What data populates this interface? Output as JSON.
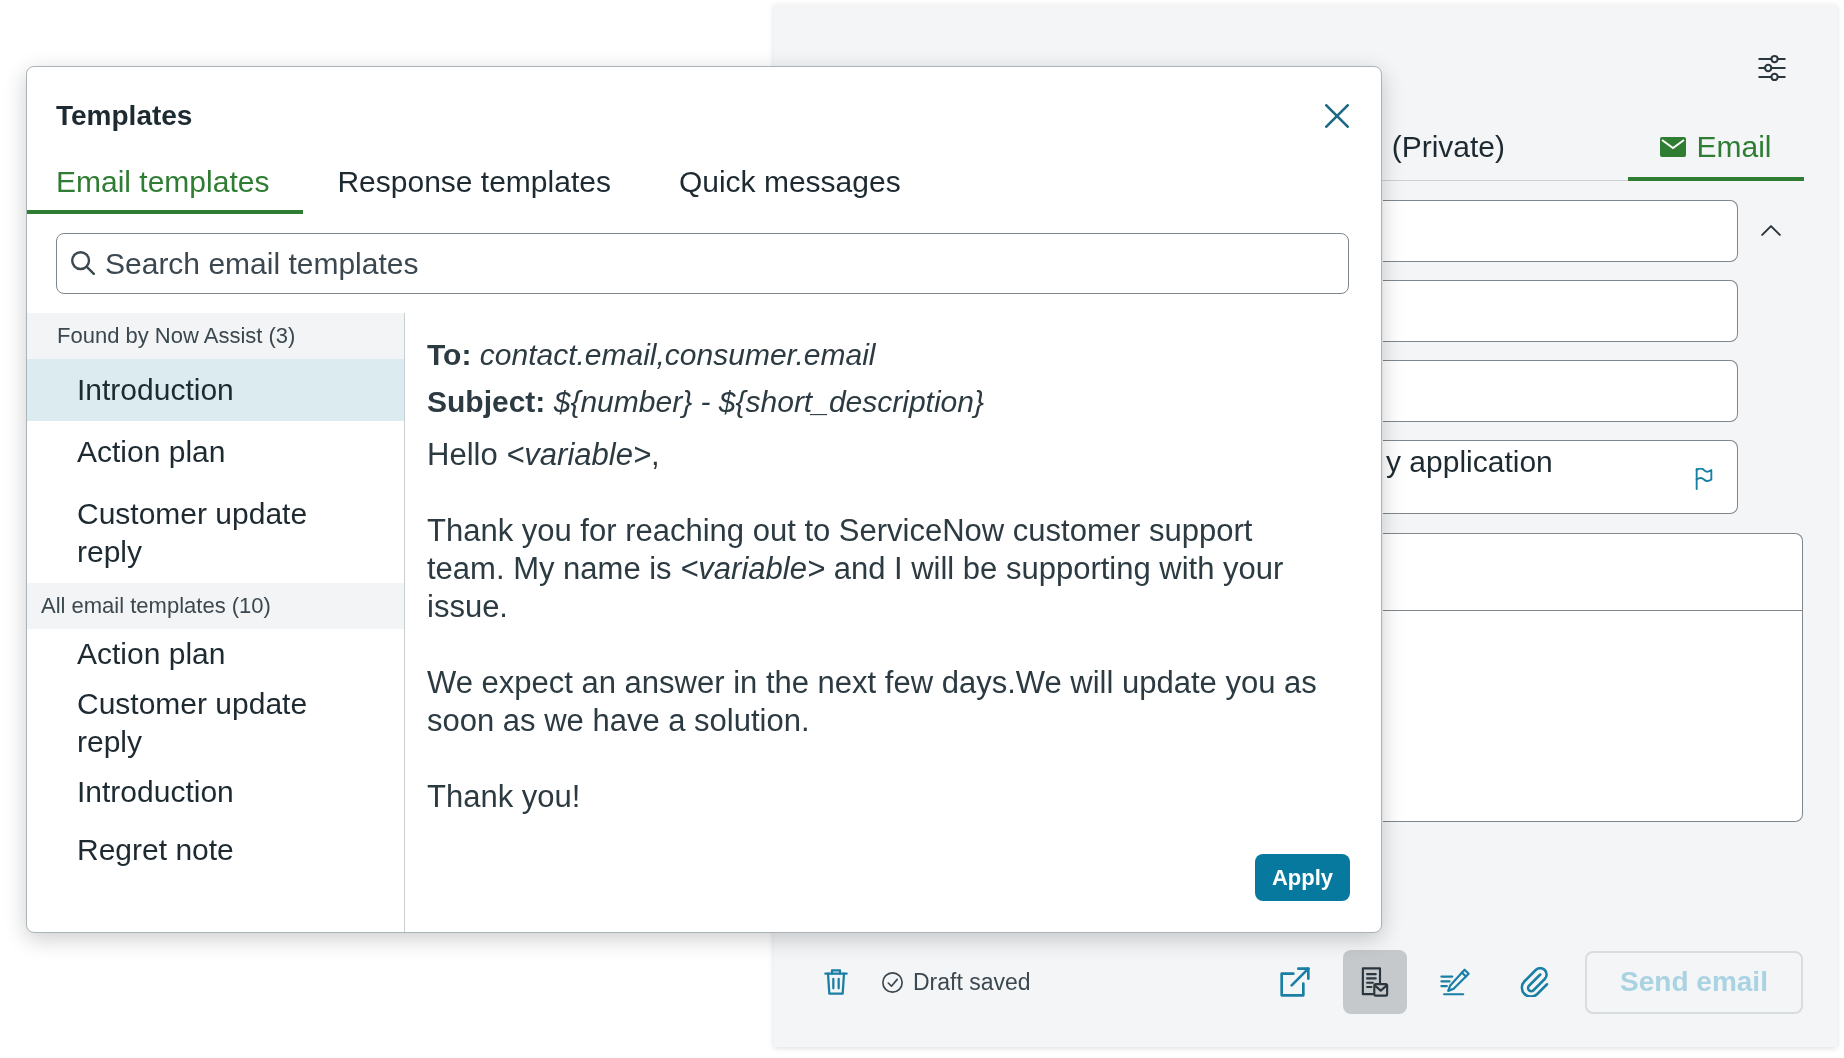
{
  "compose": {
    "tabs": [
      {
        "kind": "notes",
        "label": "(Private)",
        "selected": false
      },
      {
        "kind": "email",
        "label": "Email",
        "selected": true
      }
    ],
    "fields": [
      {
        "kind": "collapsible"
      },
      {
        "kind": "plain"
      },
      {
        "kind": "plain"
      },
      {
        "kind": "flagged",
        "value": "y application"
      }
    ],
    "draft_status": "Draft saved",
    "toolbar": [
      {
        "kind": "popout",
        "selected": false
      },
      {
        "kind": "templates",
        "selected": true
      },
      {
        "kind": "writing",
        "selected": false
      },
      {
        "kind": "attach",
        "selected": false
      }
    ],
    "send_button": {
      "label": "Send email",
      "disabled": true
    }
  },
  "templates_dialog": {
    "title": "Templates",
    "tabs": [
      {
        "label": "Email templates",
        "selected": true
      },
      {
        "label": "Response templates",
        "selected": false
      },
      {
        "label": "Quick messages",
        "selected": false
      }
    ],
    "search": {
      "placeholder": "Search email templates"
    },
    "groups": [
      {
        "heading": "Found by Now Assist (3)",
        "items": [
          {
            "label": "Introduction",
            "selected": true
          },
          {
            "label": "Action plan",
            "selected": false
          },
          {
            "label": "Customer update reply",
            "selected": false
          }
        ]
      },
      {
        "heading": "All email templates (10)",
        "items": [
          {
            "label": "Action plan",
            "selected": false
          },
          {
            "label": "Customer update reply",
            "selected": false
          },
          {
            "label": "Introduction",
            "selected": false
          },
          {
            "label": "Regret note",
            "selected": false
          }
        ]
      }
    ],
    "preview": {
      "to_line": "**To:** *contact.email,consumer.email*",
      "subject_line": "**Subject:** *${number} - ${short_description}*",
      "paragraphs": [
        "Hello *<variable>*,",
        "Thank you for reaching out to ServiceNow customer support team. My name is *<variable>* and I will be supporting with your issue.",
        "We expect an answer in the next few days.We will update you as soon as we have a solution.",
        "Thank you!"
      ]
    },
    "apply_button": "Apply"
  }
}
